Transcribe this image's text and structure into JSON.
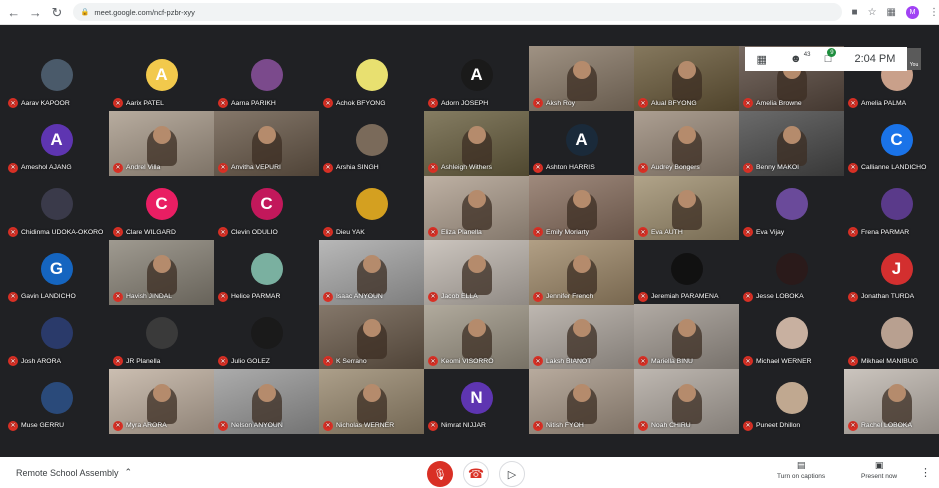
{
  "browser": {
    "url": "meet.google.com/ncf-pzbr-xyy",
    "profile_initial": "M"
  },
  "overlay": {
    "grid_icon": "grid-icon",
    "people_count": "43",
    "chat_count": "9",
    "time": "2:04 PM",
    "self_label": "You"
  },
  "meeting": {
    "name": "Remote School Assembly",
    "captions_label": "Turn on captions",
    "present_label": "Present now"
  },
  "participants": [
    {
      "name": "Aarav KAPOOR",
      "kind": "avatar",
      "color": "#4a5a6a",
      "letter": ""
    },
    {
      "name": "Aarix PATEL",
      "kind": "avatar",
      "color": "#f2c94c",
      "letter": "A"
    },
    {
      "name": "Aarna PARIKH",
      "kind": "avatar",
      "color": "#7b4a8c",
      "letter": ""
    },
    {
      "name": "Achok BFYONG",
      "kind": "avatar",
      "color": "#e8e070",
      "letter": ""
    },
    {
      "name": "Adorn JOSEPH",
      "kind": "avatar",
      "color": "#1a1a1a",
      "letter": "A"
    },
    {
      "name": "Aksh Roy",
      "kind": "photo",
      "color": "#8a7a68",
      "letter": ""
    },
    {
      "name": "Alual BFYONG",
      "kind": "photo",
      "color": "#6a5a3a",
      "letter": ""
    },
    {
      "name": "Amelia Browne",
      "kind": "photo",
      "color": "#5a4a40",
      "letter": ""
    },
    {
      "name": "Amelia PALMA",
      "kind": "avatar",
      "color": "#c9a08a",
      "letter": ""
    },
    {
      "name": "Ameshol AJANG",
      "kind": "avatar",
      "color": "#5e35b1",
      "letter": "A"
    },
    {
      "name": "Andrel Villa",
      "kind": "photo",
      "color": "#a89a8a",
      "letter": ""
    },
    {
      "name": "Anvitha VEPURI",
      "kind": "photo",
      "color": "#6a5a4a",
      "letter": ""
    },
    {
      "name": "Arshia SINGH",
      "kind": "avatar",
      "color": "#7a6a5a",
      "letter": ""
    },
    {
      "name": "Ashleigh Withers",
      "kind": "photo",
      "color": "#6a6040",
      "letter": ""
    },
    {
      "name": "Ashton HARRIS",
      "kind": "avatar",
      "color": "#1a2a3a",
      "letter": "A"
    },
    {
      "name": "Audrey Bongers",
      "kind": "photo",
      "color": "#9a8a7a",
      "letter": ""
    },
    {
      "name": "Benny MAKOI",
      "kind": "photo",
      "color": "#4a4a4a",
      "letter": ""
    },
    {
      "name": "Callianne LANDICHO",
      "kind": "avatar",
      "color": "#1a73e8",
      "letter": "C"
    },
    {
      "name": "Chidinma UDOKA-OKORO",
      "kind": "avatar",
      "color": "#3a3a4a",
      "letter": ""
    },
    {
      "name": "Clare WILGARD",
      "kind": "avatar",
      "color": "#e91e63",
      "letter": "C"
    },
    {
      "name": "Clevin ODULIO",
      "kind": "avatar",
      "color": "#c2185b",
      "letter": "C"
    },
    {
      "name": "Dieu YAK",
      "kind": "avatar",
      "color": "#d4a020",
      "letter": ""
    },
    {
      "name": "Eliza Planella",
      "kind": "photo",
      "color": "#b0a090",
      "letter": ""
    },
    {
      "name": "Emily Moriarty",
      "kind": "photo",
      "color": "#8a7060",
      "letter": ""
    },
    {
      "name": "Eva AUTH",
      "kind": "photo",
      "color": "#a09070",
      "letter": ""
    },
    {
      "name": "Eva Vijay",
      "kind": "avatar",
      "color": "#6a4a9a",
      "letter": ""
    },
    {
      "name": "Frena PARMAR",
      "kind": "avatar",
      "color": "#5a3a8a",
      "letter": ""
    },
    {
      "name": "Gavin LANDICHO",
      "kind": "avatar",
      "color": "#1565c0",
      "letter": "G"
    },
    {
      "name": "Havish JINDAL",
      "kind": "photo",
      "color": "#8a8478",
      "letter": ""
    },
    {
      "name": "Helice PARMAR",
      "kind": "avatar",
      "color": "#7ab0a0",
      "letter": ""
    },
    {
      "name": "Isaac ANYOUN",
      "kind": "photo",
      "color": "#a8a8a8",
      "letter": ""
    },
    {
      "name": "Jacob ELLA",
      "kind": "photo",
      "color": "#c0b8b0",
      "letter": ""
    },
    {
      "name": "Jennifer French",
      "kind": "photo",
      "color": "#a08a6a",
      "letter": ""
    },
    {
      "name": "Jeremiah PARAMENA",
      "kind": "avatar",
      "color": "#111111",
      "letter": ""
    },
    {
      "name": "Jesse LOBOKA",
      "kind": "avatar",
      "color": "#2a1a1a",
      "letter": ""
    },
    {
      "name": "Jonathan TURDA",
      "kind": "avatar",
      "color": "#d32f2f",
      "letter": "J"
    },
    {
      "name": "Josh ARORA",
      "kind": "avatar",
      "color": "#2a3a6a",
      "letter": ""
    },
    {
      "name": "JR Planella",
      "kind": "avatar",
      "color": "#3a3a3a",
      "letter": ""
    },
    {
      "name": "Julio GOLEZ",
      "kind": "avatar",
      "color": "#1a1a1a",
      "letter": ""
    },
    {
      "name": "K Serrano",
      "kind": "photo",
      "color": "#6a5a4a",
      "letter": ""
    },
    {
      "name": "Keomi VISORRO",
      "kind": "photo",
      "color": "#a09888",
      "letter": ""
    },
    {
      "name": "Laksh BIANOT",
      "kind": "photo",
      "color": "#b0a8a0",
      "letter": ""
    },
    {
      "name": "Mariella BINU",
      "kind": "photo",
      "color": "#a09890",
      "letter": ""
    },
    {
      "name": "Michael WERNER",
      "kind": "avatar",
      "color": "#c8b0a0",
      "letter": ""
    },
    {
      "name": "Mikhael MANIBUG",
      "kind": "avatar",
      "color": "#b8a090",
      "letter": ""
    },
    {
      "name": "Muse GERRU",
      "kind": "avatar",
      "color": "#2a4a7a",
      "letter": ""
    },
    {
      "name": "Myra ARORA",
      "kind": "photo",
      "color": "#c0b0a0",
      "letter": ""
    },
    {
      "name": "Nelson ANYOUN",
      "kind": "photo",
      "color": "#9a9a9a",
      "letter": ""
    },
    {
      "name": "Nicholas WERNER",
      "kind": "photo",
      "color": "#9a8a70",
      "letter": ""
    },
    {
      "name": "Nimrat NIJJAR",
      "kind": "avatar",
      "color": "#5e35b1",
      "letter": "N"
    },
    {
      "name": "Nitish FYOH",
      "kind": "photo",
      "color": "#a89888",
      "letter": ""
    },
    {
      "name": "Noah CHIRU",
      "kind": "photo",
      "color": "#b0a8a0",
      "letter": ""
    },
    {
      "name": "Puneet Dhillon",
      "kind": "avatar",
      "color": "#c0a890",
      "letter": ""
    },
    {
      "name": "Rachel LOBOKA",
      "kind": "photo",
      "color": "#c0b8b0",
      "letter": ""
    }
  ]
}
